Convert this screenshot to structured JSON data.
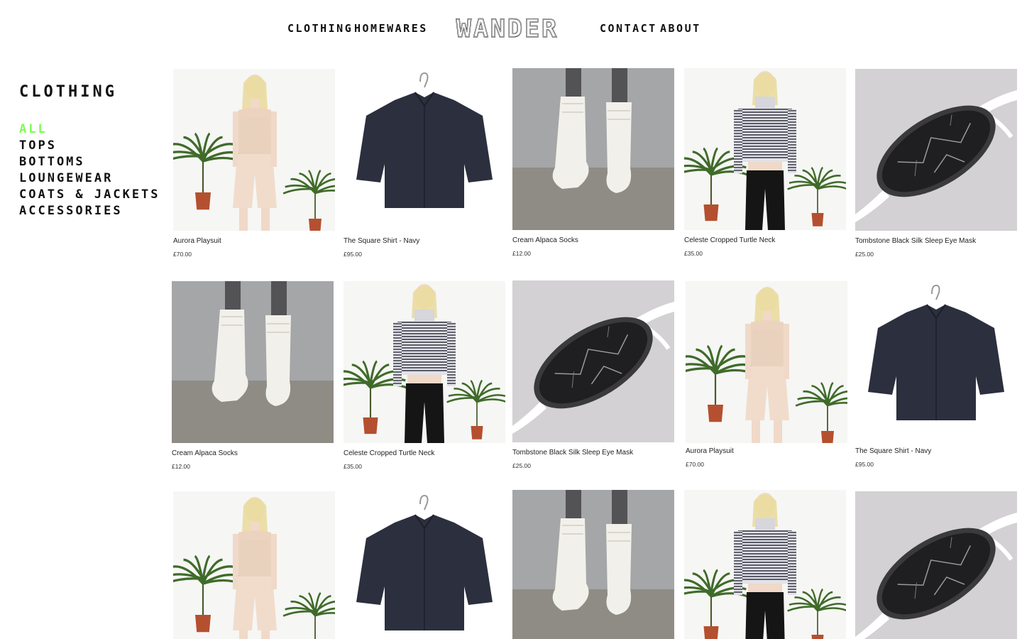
{
  "nav": {
    "clothing": "CLOTHING",
    "homewares": "HOMEWARES",
    "logo": "WANDER",
    "contact": "CONTACT",
    "about": "ABOUT"
  },
  "sidebar": {
    "title": "CLOTHING",
    "items": [
      {
        "label": "ALL",
        "active": true
      },
      {
        "label": "TOPS"
      },
      {
        "label": "BOTTOMS"
      },
      {
        "label": "LOUNGEWEAR"
      },
      {
        "label": "COATS & JACKETS"
      },
      {
        "label": "ACCESSORIES"
      }
    ]
  },
  "products": [
    {
      "name": "Aurora Playsuit",
      "price": "£70.00",
      "image": "playsuit"
    },
    {
      "name": "The Square Shirt - Navy",
      "price": "£95.00",
      "image": "shirt"
    },
    {
      "name": "Cream Alpaca Socks",
      "price": "£12.00",
      "image": "socks"
    },
    {
      "name": "Celeste Cropped Turtle Neck",
      "price": "£35.00",
      "image": "turtleneck"
    },
    {
      "name": "Tombstone Black Silk Sleep Eye Mask",
      "price": "£25.00",
      "image": "eyemask"
    },
    {
      "name": "Cream Alpaca Socks",
      "price": "£12.00",
      "image": "socks"
    },
    {
      "name": "Celeste Cropped Turtle Neck",
      "price": "£35.00",
      "image": "turtleneck"
    },
    {
      "name": "Tombstone Black Silk Sleep Eye Mask",
      "price": "£25.00",
      "image": "eyemask"
    },
    {
      "name": "Aurora Playsuit",
      "price": "£70.00",
      "image": "playsuit"
    },
    {
      "name": "The Square Shirt - Navy",
      "price": "£95.00",
      "image": "shirt"
    },
    {
      "name": "",
      "price": "",
      "image": "playsuit"
    },
    {
      "name": "",
      "price": "",
      "image": "shirt"
    },
    {
      "name": "",
      "price": "",
      "image": "socks"
    },
    {
      "name": "",
      "price": "",
      "image": "turtleneck"
    },
    {
      "name": "",
      "price": "",
      "image": "eyemask"
    }
  ],
  "colors": {
    "accent": "#7dfc52",
    "text": "#111111",
    "background": "#ffffff"
  }
}
